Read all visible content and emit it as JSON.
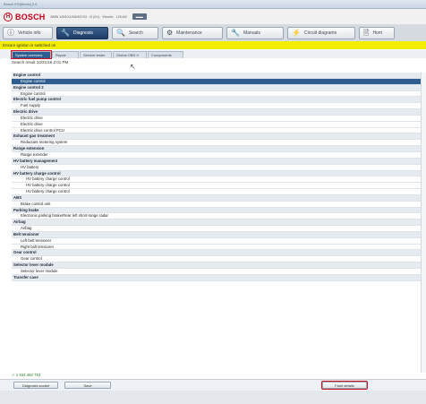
{
  "window": {
    "title": "Bosch ESI[tronic] 2.0"
  },
  "header": {
    "brand": "BOSCH",
    "vehicle_info": "BMW 1/5/6/X1/M6/M7/X3 · i3 (I01) · Electric · 125 kW",
    "badge": "▬▬"
  },
  "toolbar": {
    "items": [
      {
        "label": "Vehicle info",
        "icon": "ⓘ",
        "active": false
      },
      {
        "label": "Diagnosis",
        "icon": "🔧",
        "active": true
      },
      {
        "label": "Search",
        "icon": "🔍",
        "active": false
      },
      {
        "label": "Maintenance",
        "icon": "⚙",
        "active": false
      },
      {
        "label": "Manuals",
        "icon": "🔧",
        "active": false
      },
      {
        "label": "Circuit diagrams",
        "icon": "⚡",
        "active": false
      },
      {
        "label": "Hom",
        "icon": "🗎",
        "active": false
      }
    ]
  },
  "notice": {
    "text": "Ensure ignition is switched on"
  },
  "tabs": [
    {
      "label": "System overview",
      "active": true
    },
    {
      "label": "Repair",
      "active": false
    },
    {
      "label": "Service tester",
      "active": false
    },
    {
      "label": "Global OBD II",
      "active": false
    },
    {
      "label": "Components",
      "active": false
    }
  ],
  "timestamp": "Search result  10/21/16  2:01 PM",
  "tree": {
    "rows": [
      {
        "type": "group",
        "label": "Engine control"
      },
      {
        "type": "item",
        "label": "Engine control",
        "selected": true
      },
      {
        "type": "group",
        "label": "Engine control 2"
      },
      {
        "type": "item",
        "label": "Engine control"
      },
      {
        "type": "group",
        "label": "Electric fuel pump control"
      },
      {
        "type": "item",
        "label": "Fuel supply"
      },
      {
        "type": "group",
        "label": "Electric drive"
      },
      {
        "type": "item",
        "label": "Electric drive"
      },
      {
        "type": "item",
        "label": "Electric drive"
      },
      {
        "type": "item",
        "label": "Electric drive control PCU"
      },
      {
        "type": "group",
        "label": "Exhaust gas treatment"
      },
      {
        "type": "item",
        "label": "Reductant metering system"
      },
      {
        "type": "group",
        "label": "Range extension"
      },
      {
        "type": "item",
        "label": "Range extender"
      },
      {
        "type": "group",
        "label": "HV battery management"
      },
      {
        "type": "item",
        "label": "HV battery"
      },
      {
        "type": "group",
        "label": "HV battery charge control"
      },
      {
        "type": "item",
        "label": "HV battery charge control",
        "indent": 2
      },
      {
        "type": "item",
        "label": "HV battery charge control",
        "indent": 2
      },
      {
        "type": "item",
        "label": "HV battery charge control",
        "indent": 2
      },
      {
        "type": "group",
        "label": "ABS"
      },
      {
        "type": "item",
        "label": "Brake control unit"
      },
      {
        "type": "group",
        "label": "Parking brake"
      },
      {
        "type": "item",
        "label": "Electronic parking brake/Rear left short-range radar"
      },
      {
        "type": "group",
        "label": "Airbag"
      },
      {
        "type": "item",
        "label": "Airbag"
      },
      {
        "type": "group",
        "label": "Belt tensioner"
      },
      {
        "type": "item",
        "label": "Left belt tensioner"
      },
      {
        "type": "item",
        "label": "Right belt tensioner"
      },
      {
        "type": "group",
        "label": "Gear control"
      },
      {
        "type": "item",
        "label": "Gear control"
      },
      {
        "type": "group",
        "label": "Selector lever module"
      },
      {
        "type": "item",
        "label": "Selector lever module"
      },
      {
        "type": "group",
        "label": "Transfer case"
      }
    ]
  },
  "part_number": "✓ 1 934 460 753",
  "bottom": {
    "diagnosis_socket": "Diagnosis socket",
    "save": "Save",
    "fault_details": "Fault details"
  },
  "colors": {
    "brand_red": "#c0001a",
    "selection_blue": "#2f5d8f",
    "notice_yellow": "#f3ee00",
    "highlight_red": "#d01020"
  }
}
